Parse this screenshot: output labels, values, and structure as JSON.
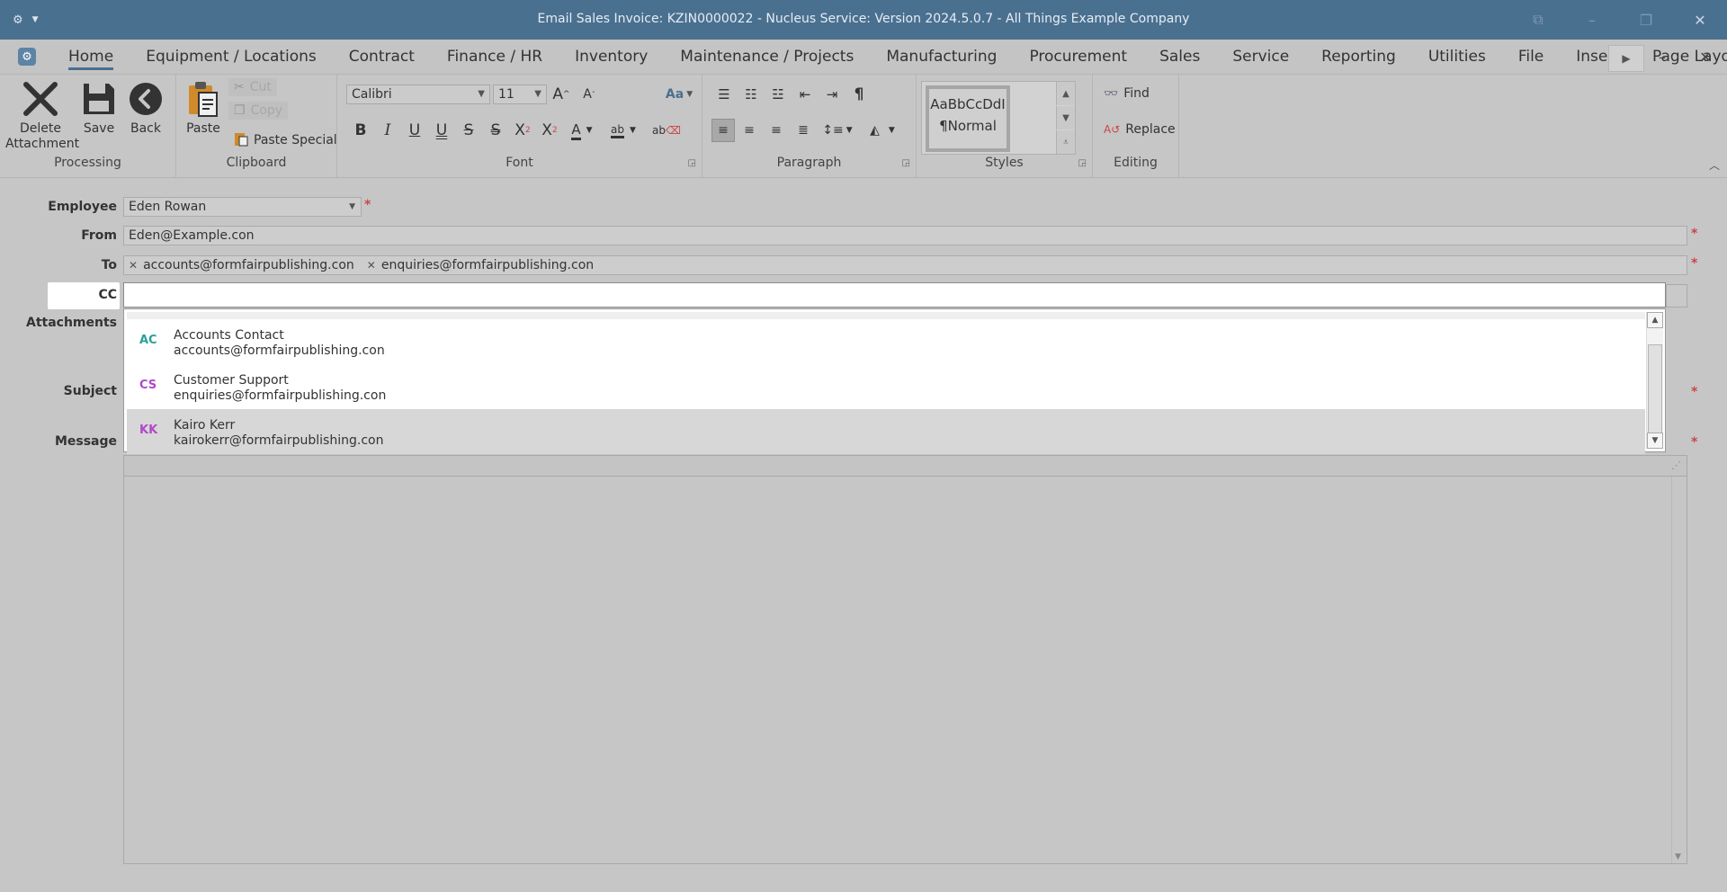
{
  "window": {
    "title": "Email Sales Invoice: KZIN0000022 - Nucleus Service: Version 2024.5.0.7 - All Things Example Company"
  },
  "menu_tabs": [
    {
      "label": "Home",
      "active": true
    },
    {
      "label": "Equipment / Locations"
    },
    {
      "label": "Contract"
    },
    {
      "label": "Finance / HR"
    },
    {
      "label": "Inventory"
    },
    {
      "label": "Maintenance / Projects"
    },
    {
      "label": "Manufacturing"
    },
    {
      "label": "Procurement"
    },
    {
      "label": "Sales"
    },
    {
      "label": "Service"
    },
    {
      "label": "Reporting"
    },
    {
      "label": "Utilities"
    },
    {
      "label": "File"
    },
    {
      "label": "Insert"
    },
    {
      "label": "Page Layo"
    }
  ],
  "ribbon": {
    "processing": {
      "label": "Processing",
      "delete_attachment": "Delete Attachment",
      "delete_line1": "Delete",
      "delete_line2": "Attachment",
      "save": "Save",
      "back": "Back"
    },
    "clipboard": {
      "label": "Clipboard",
      "paste": "Paste",
      "cut": "Cut",
      "copy": "Copy",
      "paste_special": "Paste Special"
    },
    "font": {
      "label": "Font",
      "family": "Calibri",
      "size": "11"
    },
    "paragraph": {
      "label": "Paragraph"
    },
    "styles": {
      "label": "Styles",
      "preview": "AaBbCcDdI",
      "style_name": "¶Normal"
    },
    "editing": {
      "label": "Editing",
      "find": "Find",
      "replace": "Replace"
    }
  },
  "form": {
    "employee": {
      "label": "Employee",
      "value": "Eden Rowan"
    },
    "from": {
      "label": "From",
      "value": "Eden@Example.con"
    },
    "to": {
      "label": "To",
      "recipients": [
        "accounts@formfairpublishing.con",
        "enquiries@formfairpublishing.con"
      ]
    },
    "cc": {
      "label": "CC",
      "value": ""
    },
    "attachments": {
      "label": "Attachments"
    },
    "subject": {
      "label": "Subject"
    },
    "message": {
      "label": "Message"
    },
    "required_mark": "*"
  },
  "cc_suggestions": [
    {
      "initials": "AC",
      "name": "Accounts Contact",
      "email": "accounts@formfairpublishing.con",
      "color": "#2aa198",
      "selected": false
    },
    {
      "initials": "CS",
      "name": "Customer Support",
      "email": "enquiries@formfairpublishing.con",
      "color": "#b049c9",
      "selected": false
    },
    {
      "initials": "KK",
      "name": "Kairo Kerr",
      "email": "kairokerr@formfairpublishing.con",
      "color": "#b049c9",
      "selected": true
    }
  ],
  "colors": {
    "titlebar": "#4a7090",
    "accent": "#4a7090",
    "required": "#cc4444"
  }
}
